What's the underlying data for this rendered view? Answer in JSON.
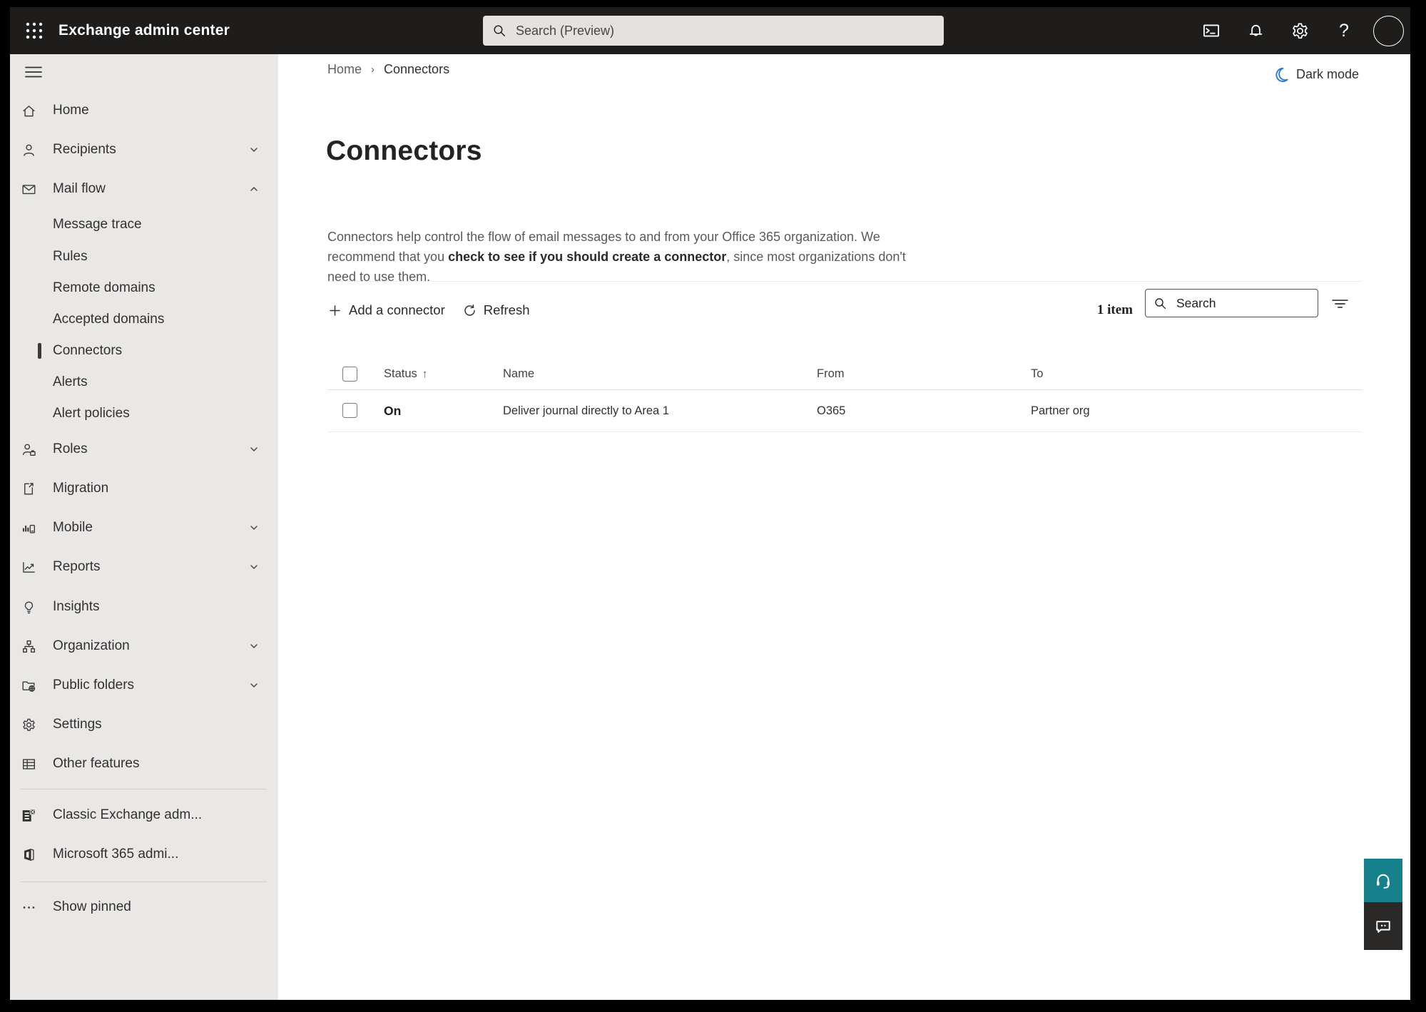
{
  "colors": {
    "topbar_bg": "#1e1d1c",
    "sidebar_bg": "#e9e8e7",
    "accent_teal": "#17808d",
    "feedback_dark": "#2b2927",
    "moon_blue": "#2b7cd3",
    "selected_bar": "#3b3a39",
    "text_primary": "#323130",
    "text_secondary": "#605e5c"
  },
  "topbar": {
    "app_title": "Exchange admin center",
    "search_placeholder": "Search (Preview)"
  },
  "breadcrumb": {
    "home": "Home",
    "current": "Connectors"
  },
  "dark_mode_label": "Dark mode",
  "page": {
    "title": "Connectors",
    "intro_before": "Connectors help control the flow of email messages to and from your Office 365 organization. We recommend that you ",
    "intro_link": "check to see if you should create a connector",
    "intro_after": ", since most organizations don't need to use them."
  },
  "toolbar": {
    "add_connector": "Add a connector",
    "refresh": "Refresh",
    "item_count": "1 item",
    "search_placeholder": "Search"
  },
  "table": {
    "headers": {
      "status": "Status",
      "name": "Name",
      "from": "From",
      "to": "To"
    },
    "rows": [
      {
        "status": "On",
        "name": "Deliver journal directly to Area 1",
        "from": "O365",
        "to": "Partner org"
      }
    ]
  },
  "sidebar": {
    "items": [
      {
        "label": "Home",
        "icon": "home",
        "type": "top"
      },
      {
        "label": "Recipients",
        "icon": "recipients",
        "type": "top",
        "chevron": "down"
      },
      {
        "label": "Mail flow",
        "icon": "mail-flow",
        "type": "top",
        "chevron": "up",
        "expanded": true
      },
      {
        "label": "Message trace",
        "type": "sub"
      },
      {
        "label": "Rules",
        "type": "sub"
      },
      {
        "label": "Remote domains",
        "type": "sub"
      },
      {
        "label": "Accepted domains",
        "type": "sub"
      },
      {
        "label": "Connectors",
        "type": "sub",
        "selected": true
      },
      {
        "label": "Alerts",
        "type": "sub"
      },
      {
        "label": "Alert policies",
        "type": "sub"
      },
      {
        "label": "Roles",
        "icon": "roles",
        "type": "top",
        "chevron": "down"
      },
      {
        "label": "Migration",
        "icon": "migration",
        "type": "top"
      },
      {
        "label": "Mobile",
        "icon": "mobile",
        "type": "top",
        "chevron": "down"
      },
      {
        "label": "Reports",
        "icon": "reports",
        "type": "top",
        "chevron": "down"
      },
      {
        "label": "Insights",
        "icon": "insights",
        "type": "top"
      },
      {
        "label": "Organization",
        "icon": "organization",
        "type": "top",
        "chevron": "down"
      },
      {
        "label": "Public folders",
        "icon": "public-folders",
        "type": "top",
        "chevron": "down"
      },
      {
        "label": "Settings",
        "icon": "settings",
        "type": "top"
      },
      {
        "label": "Other features",
        "icon": "other-features",
        "type": "top"
      },
      {
        "label": "Classic Exchange adm...",
        "icon": "classic-exchange",
        "type": "top"
      },
      {
        "label": "Microsoft 365 admi...",
        "icon": "microsoft-365",
        "type": "top"
      },
      {
        "label": "Show pinned",
        "icon": "show-pinned",
        "type": "top"
      }
    ]
  },
  "icons": {
    "app-launcher": "3x3-dot-grid",
    "search": "magnifier",
    "cloud-shell": "terminal-window",
    "notifications": "bell",
    "settings": "gear",
    "help": "question-mark",
    "account": "avatar-circle",
    "menu": "hamburger",
    "home": "house",
    "recipients": "person",
    "mail-flow": "envelope",
    "chevron-down": "v-chevron",
    "chevron-up": "caret-up",
    "roles": "person-with-briefcase",
    "migration": "document-with-arrow",
    "mobile": "bar-chart-with-phone",
    "reports": "line-chart",
    "insights": "lightbulb",
    "organization": "org-tree",
    "public-folders": "folder-with-globe",
    "other-features": "table-grid",
    "classic-exchange": "exchange-logo",
    "microsoft-365": "office-logo",
    "show-pinned": "ellipsis",
    "dark-mode": "crescent-moon",
    "add": "plus",
    "refresh": "circular-arrow",
    "sort-asc": "up-arrow",
    "filter": "decreasing-lines",
    "support": "headset",
    "feedback": "chat-bubble"
  }
}
